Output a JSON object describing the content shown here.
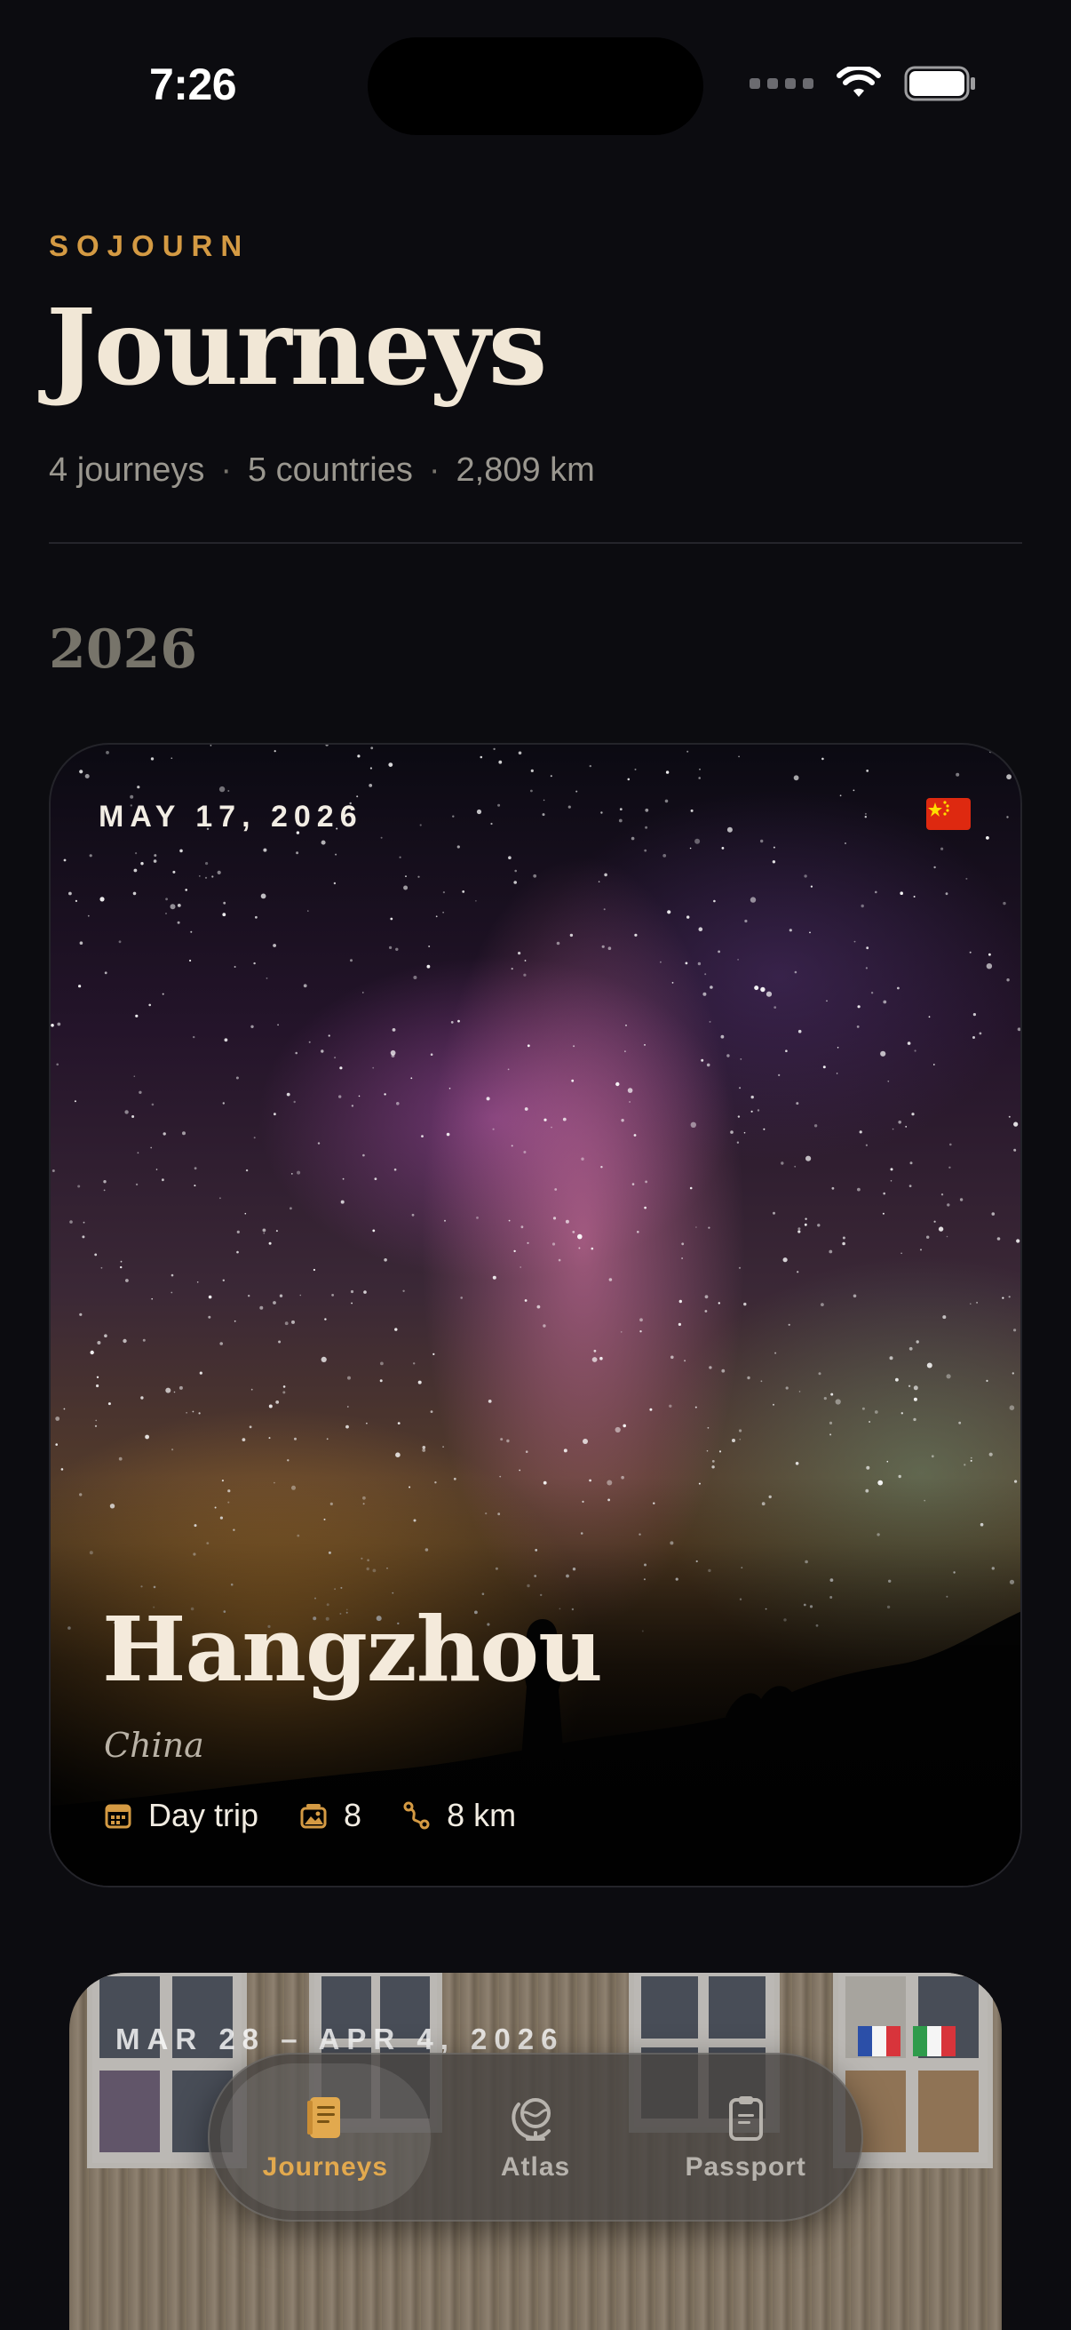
{
  "status_bar": {
    "time": "7:26"
  },
  "header": {
    "app_label": "SOJOURN",
    "title": "Journeys",
    "stats": [
      "4 journeys",
      "5 countries",
      "2,809 km"
    ],
    "stats_separator": "·"
  },
  "year_section": {
    "year": "2026"
  },
  "journeys": [
    {
      "date": "MAY 17, 2026",
      "city": "Hangzhou",
      "country": "China",
      "meta": {
        "duration": "Day trip",
        "photos": "8",
        "distance": "8 km"
      },
      "flags": [
        "china-flag-icon"
      ]
    },
    {
      "date": "MAR 28 – APR 4, 2026",
      "flags": [
        "france-flag-icon",
        "italy-flag-icon"
      ]
    }
  ],
  "tabbar": {
    "tabs": [
      {
        "label": "Journeys",
        "icon": "journal-icon",
        "active": true
      },
      {
        "label": "Atlas",
        "icon": "globe-icon",
        "active": false
      },
      {
        "label": "Passport",
        "icon": "clipboard-icon",
        "active": false
      }
    ]
  },
  "colors": {
    "accent": "#d49a43",
    "background": "#0c0c10",
    "title": "#f1e7d6",
    "muted": "#9a978f"
  }
}
